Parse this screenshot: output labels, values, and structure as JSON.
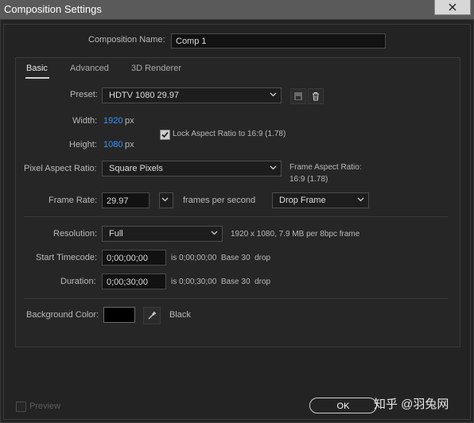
{
  "window": {
    "title": "Composition Settings"
  },
  "comp_name": {
    "label": "Composition Name:",
    "value": "Comp 1"
  },
  "tabs": [
    {
      "label": "Basic",
      "active": true
    },
    {
      "label": "Advanced",
      "active": false
    },
    {
      "label": "3D Renderer",
      "active": false
    }
  ],
  "preset": {
    "label": "Preset:",
    "value": "HDTV 1080 29.97"
  },
  "width": {
    "label": "Width:",
    "value": "1920",
    "unit": "px"
  },
  "height": {
    "label": "Height:",
    "value": "1080",
    "unit": "px"
  },
  "lock_aspect": {
    "label": "Lock Aspect Ratio to 16:9 (1.78)",
    "checked": true
  },
  "pixel_aspect": {
    "label": "Pixel Aspect Ratio:",
    "value": "Square Pixels"
  },
  "frame_aspect": {
    "line1": "Frame Aspect Ratio:",
    "line2": "16:9 (1.78)"
  },
  "frame_rate": {
    "label": "Frame Rate:",
    "value": "29.97",
    "unit": "frames per second",
    "mode": "Drop Frame"
  },
  "resolution": {
    "label": "Resolution:",
    "value": "Full",
    "info": "1920 x 1080, 7.9 MB per 8bpc frame"
  },
  "start_timecode": {
    "label": "Start Timecode:",
    "value": "0;00;00;00",
    "info": "is 0;00;00;00  Base 30  drop"
  },
  "duration": {
    "label": "Duration:",
    "value": "0;00;30;00",
    "info": "is 0;00;30;00  Base 30  drop"
  },
  "background": {
    "label": "Background Color:",
    "color": "#000000",
    "name": "Black"
  },
  "preview": {
    "label": "Preview",
    "checked": false
  },
  "buttons": {
    "ok": "OK"
  },
  "watermark": "知乎 @羽兔网",
  "colors": {
    "accent": "#3d93f5",
    "bg": "#232323"
  }
}
